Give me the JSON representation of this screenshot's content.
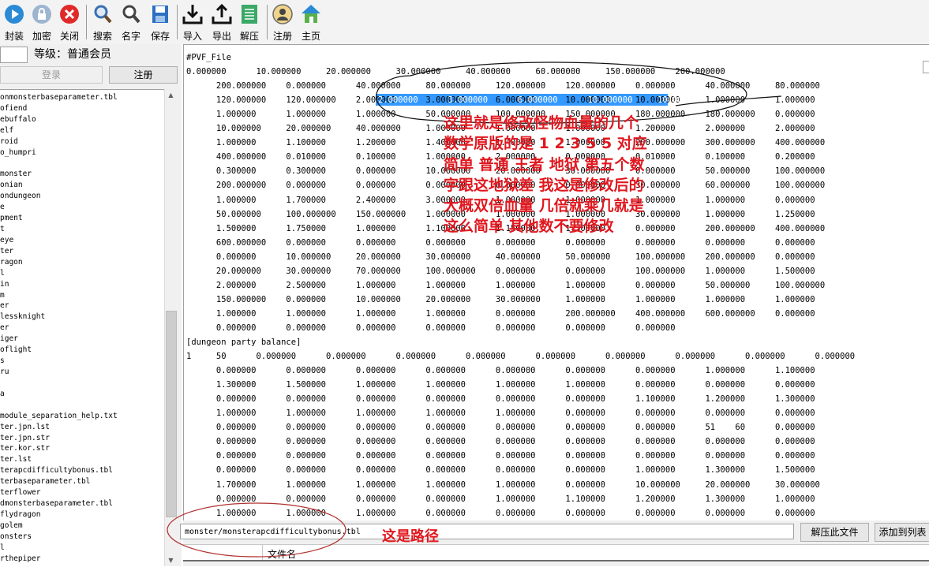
{
  "toolbar": [
    {
      "label": "封装",
      "icon": "play-circle-icon"
    },
    {
      "label": "加密",
      "icon": "lock-icon"
    },
    {
      "label": "关闭",
      "icon": "close-icon"
    },
    {
      "label": "搜索",
      "icon": "search-icon"
    },
    {
      "label": "名字",
      "icon": "name-search-icon"
    },
    {
      "label": "保存",
      "icon": "save-icon"
    },
    {
      "label": "导入",
      "icon": "import-icon"
    },
    {
      "label": "导出",
      "icon": "export-icon"
    },
    {
      "label": "解压",
      "icon": "extract-icon"
    },
    {
      "label": "注册",
      "icon": "user-icon"
    },
    {
      "label": "主页",
      "icon": "home-icon"
    }
  ],
  "left_panel": {
    "level": "等级：普通会员",
    "login_label": "登录",
    "register_label": "注册",
    "files": [
      "onmonsterbaseparameter.tbl",
      "ofiend",
      "ebuffalo",
      "elf",
      "roid",
      "o_humpri",
      "",
      "monster",
      "onian",
      "ondungeon",
      "e",
      "pment",
      "t",
      "eye",
      "ter",
      "ragon",
      "l",
      "in",
      "m",
      "er",
      "lessknight",
      "er",
      "iger",
      "oflight",
      "s",
      "ru",
      "",
      "a",
      "",
      "module_separation_help.txt",
      "ter.jpn.lst",
      "ter.jpn.str",
      "ter.kor.str",
      "ter.lst",
      "terapcdifficultybonus.tbl",
      "terbaseparameter.tbl",
      "terflower",
      "dmonsterbaseparameter.tbl",
      "flydragon",
      "golem",
      "onsters",
      "l",
      "rthepiper"
    ]
  },
  "main_text": {
    "lines": [
      "#PVF_File",
      "0.000000      10.000000     20.000000     30.000000     40.000000     60.000000     150.000000    200.000000",
      "      200.000000    0.000000      40.000000     80.000000     120.000000    120.000000    0.000000      40.000000     80.000000",
      "      120.000000    120.000000    2.000000      3.000000      6.000000      10.000000     10.000000     1.000000      1.000000",
      "      1.000000      1.000000      1.000000      50.000000     100.000000    150.000000    180.000000    180.000000    0.000000",
      "      10.000000     20.000000     40.000000     1.000000      1.000000      1.000000      1.200000      2.000000      2.000000",
      "      1.000000      1.100000      1.200000      1.400000      1.400000      1.000000      200.000000    300.000000    400.000000",
      "      400.000000    0.010000      0.100000      1.000000      2.000000      0.000000      0.010000      0.100000      0.200000",
      "      0.300000      0.300000      0.000000      10.000000     20.000000     30.000000     0.000000      50.000000     100.000000",
      "      200.000000    0.000000      0.000000      0.000000      0.000000      0.000000      30.000000     60.000000     100.000000",
      "      1.000000      1.700000      2.400000      3.000000      1.000000      1.000000      1.000000      1.000000      0.000000",
      "      50.000000     100.000000    150.000000    1.000000      1.000000      1.000000      30.000000     1.000000      1.250000",
      "      1.500000      1.750000      1.000000      1.100000      1.150000      1.300000      0.000000      200.000000    400.000000",
      "      600.000000    0.000000      0.000000      0.000000      0.000000      0.000000      0.000000      0.000000      0.000000",
      "      0.000000      10.000000     20.000000     30.000000     40.000000     50.000000     100.000000    200.000000    0.000000",
      "      20.000000     30.000000     70.000000     100.000000    0.000000      0.000000      100.000000    1.000000      1.500000",
      "      2.000000      2.500000      1.000000      1.000000      1.000000      1.000000      0.000000      50.000000     100.000000",
      "      150.000000    0.000000      10.000000     20.000000     30.000000     1.000000      1.000000      1.000000      1.000000",
      "      1.000000      1.000000      1.000000      1.000000      0.000000      200.000000    400.000000    600.000000    0.000000",
      "      0.000000      0.000000      0.000000      0.000000      0.000000      0.000000      0.000000",
      "[dungeon party balance]",
      "1     50      0.000000      0.000000      0.000000      0.000000      0.000000      0.000000      0.000000      0.000000      0.000000",
      "      0.000000      0.000000      0.000000      0.000000      0.000000      0.000000      0.000000      1.000000      1.100000",
      "      1.300000      1.500000      1.000000      1.000000      1.000000      1.000000      0.000000      0.000000      0.000000",
      "      0.000000      0.000000      0.000000      0.000000      0.000000      0.000000      1.100000      1.200000      1.300000",
      "      1.000000      1.000000      1.000000      1.000000      1.000000      0.000000      0.000000      0.000000      0.000000",
      "      0.000000      0.000000      0.000000      0.000000      0.000000      0.000000      0.000000      51    60      0.000000",
      "      0.000000      0.000000      0.000000      0.000000      0.000000      0.000000      0.000000      0.000000      0.000000",
      "      0.000000      0.000000      0.000000      0.000000      0.000000      0.000000      0.000000      0.000000      0.000000",
      "      0.000000      0.000000      0.000000      0.000000      0.000000      0.000000      1.000000      1.300000      1.500000",
      "      1.700000      1.000000      1.000000      1.000000      1.000000      0.000000      10.000000     20.000000     30.000000",
      "      0.000000      0.000000      0.000000      0.000000      1.000000      1.100000      1.200000      1.300000      1.000000",
      "      1.000000      1.000000      1.000000      0.000000      0.000000      0.000000      0.000000      0.000000      0.000000",
      "      0.000000      0.000000      0.000000      0.000000      0.000000      0.000000      61    70      0.000000"
    ],
    "selected_text": "2.000000      3.000000      6.000000      10.000000     10.000000"
  },
  "bottom": {
    "path": "monster/monsterapcdifficultybonus.tbl",
    "extract_button": "解压此文件",
    "add_button": "添加到列表",
    "column_header": "文件名"
  },
  "annotations": {
    "main_note": [
      "这里就是修改怪物血量的几个",
      "数学原版的是 1 2 3 5 5 对应",
      "简单 普通 王者 地狱 第五个数",
      "字跟这地狱差 我这是修改后的",
      "大概双倍血量 几倍就乘几就是",
      "这么简单 其他数不要修改"
    ],
    "path_note": "这是路径",
    "color": "#e0181f"
  }
}
